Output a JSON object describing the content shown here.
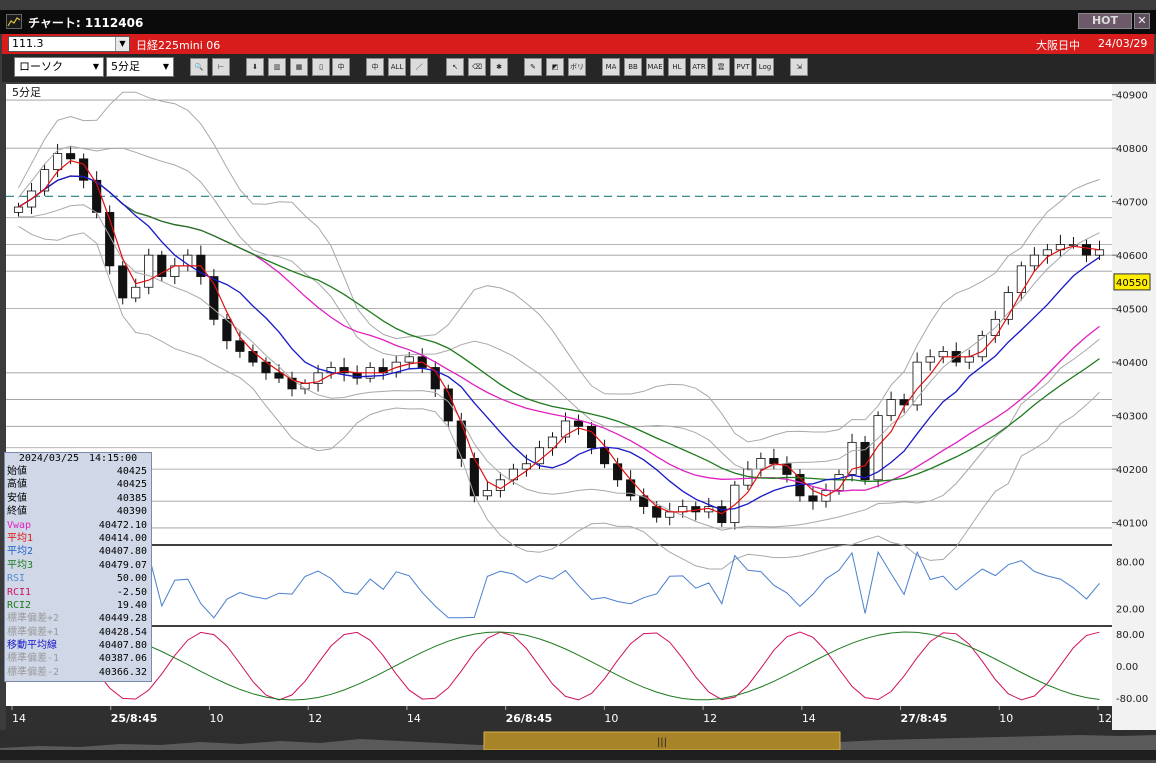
{
  "window": {
    "title": "チャート: 1112406",
    "hot_label": "HOT",
    "close_label": "✕"
  },
  "symbol_bar": {
    "code": "111.3",
    "name": "日経225mini 06",
    "market": "大阪日中",
    "date": "24/03/29"
  },
  "toolbar": {
    "chart_type": "ローソク",
    "interval": "5分足",
    "tools": [
      {
        "name": "zoom-icon",
        "label": "🔍"
      },
      {
        "name": "cursor-icon",
        "label": "⊢"
      },
      {
        "name": "download-icon",
        "label": "⬇"
      },
      {
        "name": "bar-chart-icon",
        "label": "▥"
      },
      {
        "name": "grid-icon",
        "label": "▦"
      },
      {
        "name": "page-icon",
        "label": "▯"
      },
      {
        "name": "candle-up-icon",
        "label": "中"
      },
      {
        "name": "candle-down-icon",
        "label": "中"
      },
      {
        "name": "all-icon",
        "label": "ALL"
      },
      {
        "name": "line-draw-icon",
        "label": "／"
      },
      {
        "name": "arrow-cursor-icon",
        "label": "↖"
      },
      {
        "name": "eraser-icon",
        "label": "⌫"
      },
      {
        "name": "palette-icon",
        "label": "✱"
      },
      {
        "name": "settings-icon",
        "label": "✎"
      },
      {
        "name": "color-icon",
        "label": "◩"
      },
      {
        "name": "indicator-1-icon",
        "label": "ボリ"
      },
      {
        "name": "ma-icon",
        "label": "MA"
      },
      {
        "name": "bb-icon",
        "label": "BB"
      },
      {
        "name": "mae-icon",
        "label": "MAE"
      },
      {
        "name": "hl-icon",
        "label": "HL"
      },
      {
        "name": "atr-icon",
        "label": "ATR"
      },
      {
        "name": "ichimoku-icon",
        "label": "雲"
      },
      {
        "name": "pvt-icon",
        "label": "PVT"
      },
      {
        "name": "log-icon",
        "label": "Log"
      },
      {
        "name": "export-icon",
        "label": "⇲"
      }
    ]
  },
  "chart": {
    "interval_label": "5分足",
    "current_price": "40550"
  },
  "chart_data": {
    "type": "candlestick",
    "title": "",
    "price_axis": {
      "min": 40060,
      "max": 40920,
      "ticks": [
        "40900",
        "40800",
        "40700",
        "40600",
        "40500",
        "40400",
        "40300",
        "40200",
        "40100"
      ]
    },
    "reference_line": 40710,
    "x_labels": [
      "14",
      "25/8:45",
      "10",
      "12",
      "14",
      "26/8:45",
      "10",
      "12",
      "14",
      "27/8:45",
      "10",
      "12"
    ],
    "close": [
      40690,
      40720,
      40760,
      40790,
      40780,
      40740,
      40680,
      40580,
      40520,
      40540,
      40600,
      40560,
      40580,
      40600,
      40560,
      40480,
      40440,
      40420,
      40400,
      40380,
      40370,
      40350,
      40360,
      40380,
      40390,
      40380,
      40370,
      40390,
      40380,
      40400,
      40410,
      40390,
      40350,
      40290,
      40220,
      40150,
      40160,
      40180,
      40200,
      40210,
      40240,
      40260,
      40290,
      40280,
      40240,
      40210,
      40180,
      40150,
      40130,
      40110,
      40120,
      40130,
      40120,
      40130,
      40100,
      40170,
      40200,
      40220,
      40210,
      40190,
      40150,
      40140,
      40160,
      40190,
      40250,
      40180,
      40300,
      40330,
      40320,
      40400,
      40410,
      40420,
      40400,
      40410,
      40450,
      40480,
      40530,
      40580,
      40600,
      40610,
      40620,
      40620,
      40600,
      40610
    ],
    "overlays": [
      {
        "name": "平均1",
        "color": "#e01010"
      },
      {
        "name": "平均2",
        "color": "#1818c8"
      },
      {
        "name": "平均3",
        "color": "#1d7a1d"
      },
      {
        "name": "Vwap",
        "color": "#e020c0"
      }
    ],
    "rsi": {
      "ticks": [
        "80.00",
        "20.00"
      ]
    },
    "rci": {
      "ticks": [
        "80.00",
        "0.00",
        "-80.00"
      ]
    }
  },
  "data_window": {
    "datetime": "2024/03/25　14:15:00",
    "rows": [
      {
        "label": "始値",
        "value": "40425",
        "color": "#000000"
      },
      {
        "label": "高値",
        "value": "40425",
        "color": "#000000"
      },
      {
        "label": "安値",
        "value": "40385",
        "color": "#000000"
      },
      {
        "label": "終値",
        "value": "40390",
        "color": "#000000"
      },
      {
        "label": "Vwap",
        "value": "40472.10",
        "color": "#e020c0"
      },
      {
        "label": "平均1",
        "value": "40414.00",
        "color": "#e01010"
      },
      {
        "label": "平均2",
        "value": "40407.80",
        "color": "#2060c8"
      },
      {
        "label": "平均3",
        "value": "40479.07",
        "color": "#1d7a1d"
      },
      {
        "label": "RSI",
        "value": "50.00",
        "color": "#5a8ad0"
      },
      {
        "label": "RCI1",
        "value": "-2.50",
        "color": "#d01060"
      },
      {
        "label": "RCI2",
        "value": "19.40",
        "color": "#1d7a1d"
      },
      {
        "label": "標準偏差+2",
        "value": "40449.28",
        "color": "#999999"
      },
      {
        "label": "標準偏差+1",
        "value": "40428.54",
        "color": "#999999"
      },
      {
        "label": "移動平均線",
        "value": "40407.80",
        "color": "#1818c8"
      },
      {
        "label": "標準偏差-1",
        "value": "40387.06",
        "color": "#999999"
      },
      {
        "label": "標準偏差-2",
        "value": "40366.32",
        "color": "#999999"
      }
    ]
  }
}
